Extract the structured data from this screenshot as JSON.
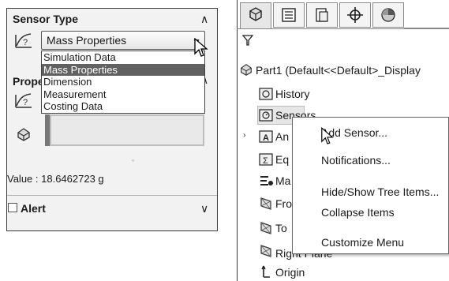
{
  "left_panel": {
    "sensor_type_title": "Sensor Type",
    "selected_type": "Mass Properties",
    "type_options": [
      "Simulation Data",
      "Mass Properties",
      "Dimension",
      "Measurement",
      "Costing Data"
    ],
    "properties_title_partial": "Prope",
    "value_text": "Value : 18.6462723 g",
    "alert_label": "Alert"
  },
  "right_panel": {
    "tabs": [
      {
        "icon": "feature-manager-icon"
      },
      {
        "icon": "property-manager-icon"
      },
      {
        "icon": "configuration-manager-icon"
      },
      {
        "icon": "dimxpert-icon"
      },
      {
        "icon": "display-manager-icon"
      }
    ],
    "tree": {
      "root": "Part1  (Default<<Default>_Display",
      "items": [
        {
          "label": "History",
          "icon": "history-icon"
        },
        {
          "label": "Sensors",
          "icon": "sensors-icon"
        },
        {
          "label": "An",
          "icon": "annotations-icon"
        },
        {
          "label": "Eq",
          "icon": "equations-icon"
        },
        {
          "label": "Ma",
          "icon": "material-icon"
        },
        {
          "label": "Fro",
          "icon": "plane-icon"
        },
        {
          "label": "To",
          "icon": "plane-icon"
        },
        {
          "label": "Right Plane",
          "icon": "plane-icon"
        },
        {
          "label": "Origin",
          "icon": "origin-icon"
        }
      ]
    },
    "context_menu": [
      "Add Sensor...",
      "Notifications...",
      "Hide/Show Tree Items...",
      "Collapse Items",
      "Customize Menu"
    ]
  }
}
